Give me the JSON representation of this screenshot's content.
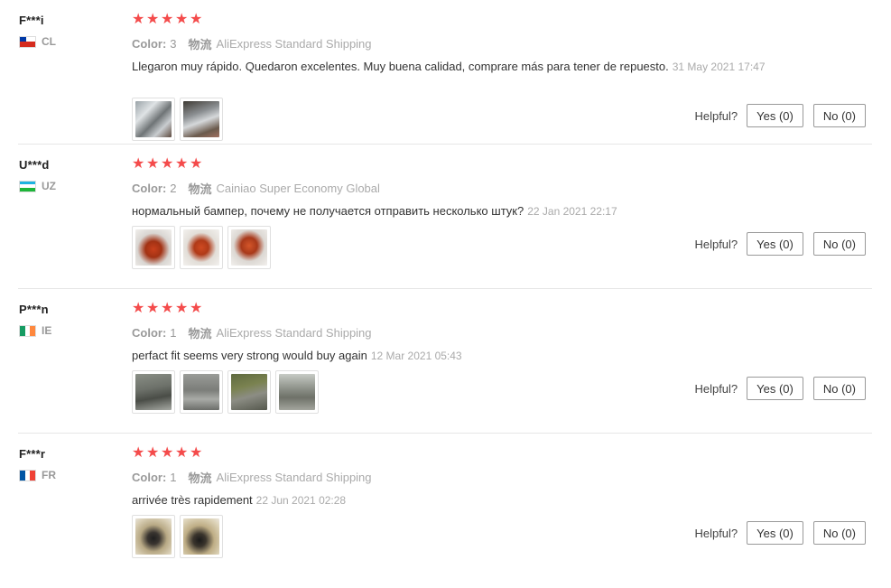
{
  "reviews": [
    {
      "user": "F***i",
      "country": "CL",
      "color_label": "Color:",
      "color_value": "3",
      "shipping_label": "物流",
      "shipping_value": "AliExpress Standard Shipping",
      "text": "Llegaron muy rápido. Quedaron excelentes. Muy buena calidad, comprare más para tener de repuesto.",
      "date": "31 May 2021 17:47",
      "helpful_label": "Helpful?",
      "yes_label": "Yes (0)",
      "no_label": "No (0)",
      "photos": 2
    },
    {
      "user": "U***d",
      "country": "UZ",
      "color_label": "Color:",
      "color_value": "2",
      "shipping_label": "物流",
      "shipping_value": "Cainiao Super Economy Global",
      "text": "нормальный бампер, почему не получается отправить несколько штук?",
      "date": "22 Jan 2021 22:17",
      "helpful_label": "Helpful?",
      "yes_label": "Yes (0)",
      "no_label": "No (0)",
      "photos": 3
    },
    {
      "user": "P***n",
      "country": "IE",
      "color_label": "Color:",
      "color_value": "1",
      "shipping_label": "物流",
      "shipping_value": "AliExpress Standard Shipping",
      "text": "perfact fit seems very strong would buy again",
      "date": "12 Mar 2021 05:43",
      "helpful_label": "Helpful?",
      "yes_label": "Yes (0)",
      "no_label": "No (0)",
      "photos": 4
    },
    {
      "user": "F***r",
      "country": "FR",
      "color_label": "Color:",
      "color_value": "1",
      "shipping_label": "物流",
      "shipping_value": "AliExpress Standard Shipping",
      "text": "arrivée très rapidement",
      "date": "22 Jun 2021 02:28",
      "helpful_label": "Helpful?",
      "yes_label": "Yes (0)",
      "no_label": "No (0)",
      "photos": 2
    }
  ],
  "star_count": 5,
  "colors": {
    "star": "#f44b4b",
    "muted": "#999999",
    "divider": "#e6e6e6"
  }
}
